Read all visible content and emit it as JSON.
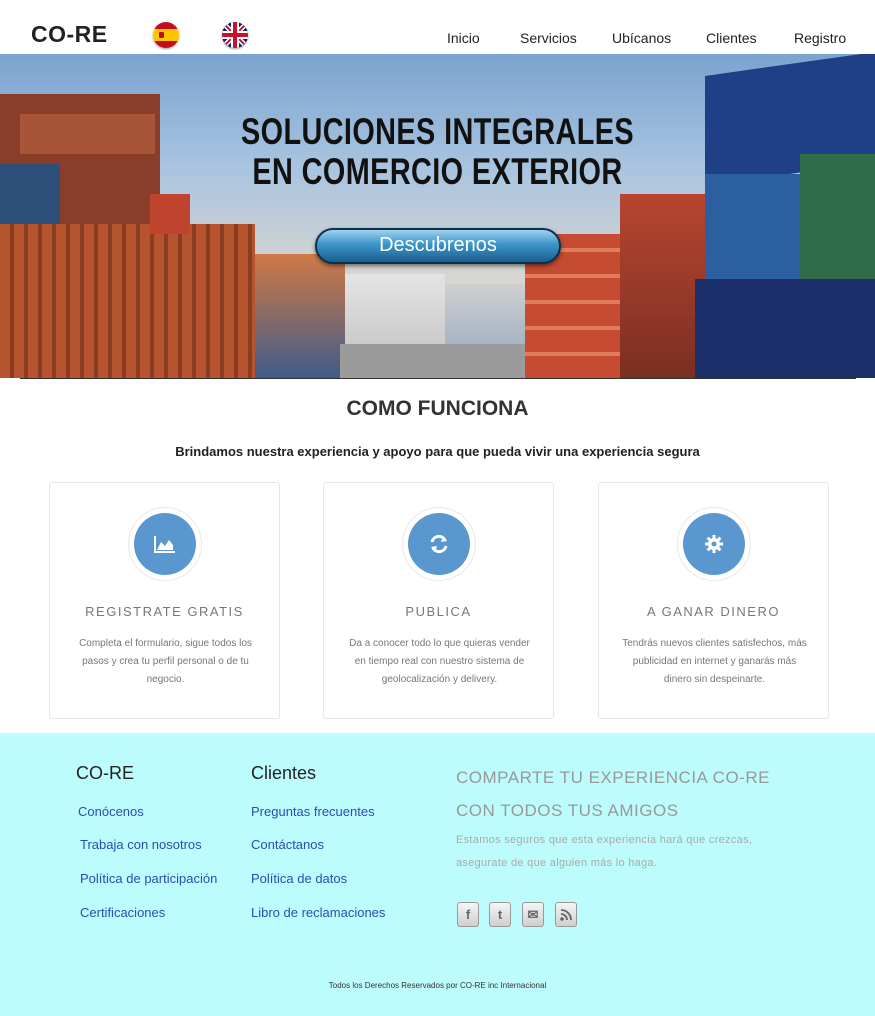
{
  "header": {
    "brand": "CO-RE",
    "languages": [
      "Español",
      "English"
    ],
    "nav": [
      "Inicio",
      "Servicios",
      "Ubícanos",
      "Clientes",
      "Registro"
    ]
  },
  "hero": {
    "title_line1": "SOLUCIONES INTEGRALES",
    "title_line2": "EN COMERCIO EXTERIOR",
    "button": "Descubrenos"
  },
  "how_it_works": {
    "title": "COMO FUNCIONA",
    "subtitle": "Brindamos nuestra experiencia y apoyo para que pueda vivir una experiencia segura",
    "cards": [
      {
        "icon": "area-chart-icon",
        "title": "REGISTRATE GRATIS",
        "text": "Completa el formulario, sigue todos los pasos y crea tu perfil personal o de tu negocio."
      },
      {
        "icon": "refresh-icon",
        "title": "PUBLICA",
        "text": "Da a conocer todo lo que quieras vender en tiempo real con nuestro sistema de geolocalización y delivery."
      },
      {
        "icon": "gear-icon",
        "title": "A GANAR DINERO",
        "text": "Tendrás nuevos clientes satisfechos, más publicidad en internet y ganarás más dinero sin despeinarte."
      }
    ]
  },
  "footer": {
    "col1": {
      "title": "CO-RE",
      "links": [
        "Conócenos",
        "Trabaja con nosotros",
        "Política de participación",
        "Certificaciones"
      ]
    },
    "col2": {
      "title": "Clientes",
      "links": [
        "Preguntas frecuentes",
        "Contáctanos",
        "Política de datos",
        "Libro de reclamaciones"
      ]
    },
    "share": {
      "title_line1": "COMPARTE TU EXPERIENCIA CO-RE",
      "title_line2": "CON TODOS TUS AMIGOS",
      "text_line1": "Estamos seguros que esta experiencia hará que crezcas,",
      "text_line2": "asegurate de que alguien más lo haga."
    },
    "social_icons": [
      "facebook-icon",
      "twitter-icon",
      "email-icon",
      "rss-icon"
    ],
    "copyright": "Todos los Derechos Reservados por CO-RE inc Internacional"
  },
  "colors": {
    "accent_blue": "#5b97cf",
    "footer_bg": "#bdfcfc",
    "link_blue": "#2a4db3"
  }
}
